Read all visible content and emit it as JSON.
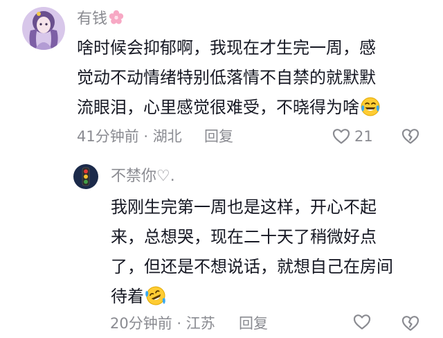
{
  "comments": [
    {
      "username": "有钱",
      "lines": [
        "啥时候会抑郁啊，我现在才生完一周，感",
        "觉动不动情绪特别低落情不自禁的就默默",
        "流眼泪，心里感觉很难受，不晓得为啥"
      ],
      "time_location": "41分钟前 · 湖北",
      "reply_label": "回复",
      "like_count": "21"
    },
    {
      "username": "不禁你♡.",
      "lines": [
        "我刚生完第一周也是这样，开心不起",
        "来，总想哭，现在二十天了稍微好点",
        "了，但还是不想说话，就想自己在房间",
        "待着"
      ],
      "time_location": "20分钟前 · 江苏",
      "reply_label": "回复",
      "like_count": ""
    }
  ],
  "icons": {
    "username_decoration": "cherry-blossom-icon",
    "emoji": "face-with-tears-of-joy-icon",
    "like": "heart-outline-icon",
    "dislike": "broken-heart-outline-icon"
  },
  "colors": {
    "text_primary": "#161823",
    "text_secondary": "#8a8b91",
    "flower_pink": "#f7a8c4"
  }
}
